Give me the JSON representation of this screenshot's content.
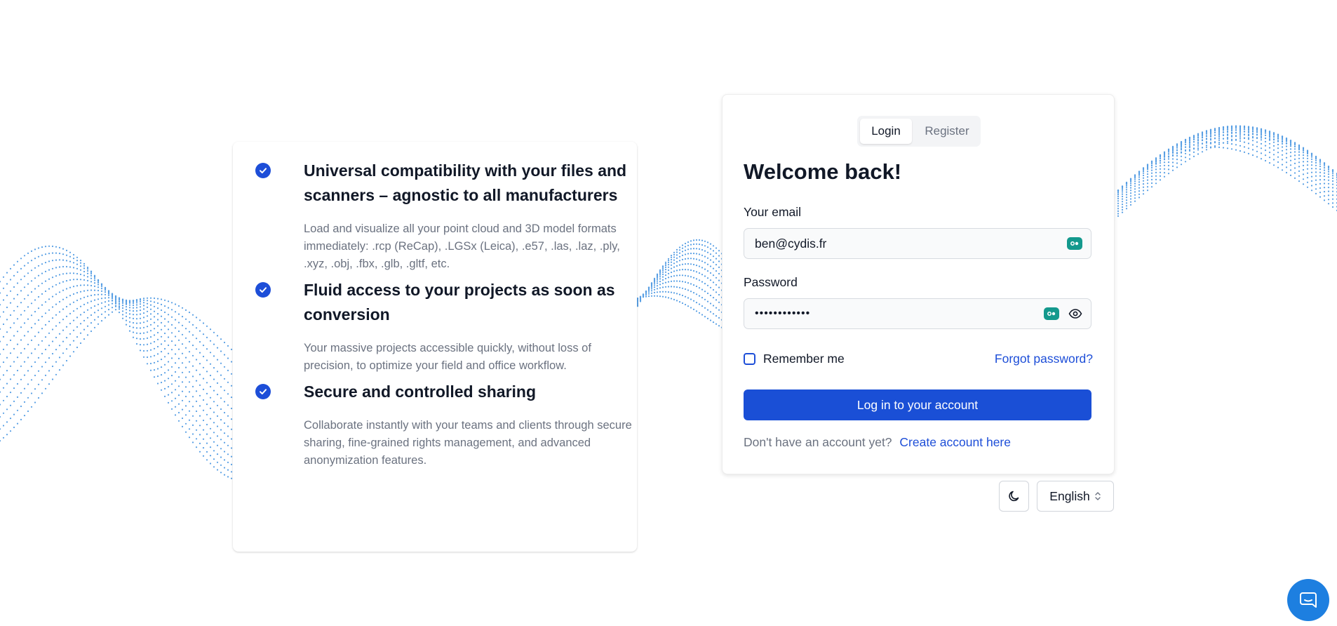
{
  "features": [
    {
      "title": "Universal compatibility with your files and scanners – agnostic to all manufacturers",
      "description": "Load and visualize all your point cloud and 3D model formats immediately: .rcp (ReCap), .LGSx (Leica), .e57, .las, .laz, .ply, .xyz, .obj, .fbx, .glb, .gltf, etc."
    },
    {
      "title": "Fluid access to your projects as soon as conversion",
      "description": "Your massive projects accessible quickly, without loss of precision, to optimize your field and office workflow."
    },
    {
      "title": "Secure and controlled sharing",
      "description": "Collaborate instantly with your teams and clients through secure sharing, fine-grained rights management, and advanced anonymization features."
    }
  ],
  "auth": {
    "tabs": {
      "login": "Login",
      "register": "Register",
      "active": "login"
    },
    "heading": "Welcome back!",
    "email_label": "Your email",
    "email_value": "ben@cydis.fr",
    "password_label": "Password",
    "password_mask": "••••••••••••",
    "remember_label": "Remember me",
    "remember_checked": false,
    "forgot_label": "Forgot password?",
    "submit_label": "Log in to your account",
    "no_account_text": "Don't have an account yet?",
    "create_account_label": "Create account here"
  },
  "footer_controls": {
    "theme_icon": "moon-icon",
    "language": "English"
  },
  "chat_widget": {
    "icon": "chat-bubble-icon"
  },
  "colors": {
    "primary": "#1a4fd6",
    "link": "#1d4ed8",
    "wave": "#3b8fe0",
    "password_manager_icon": "#14998d"
  }
}
